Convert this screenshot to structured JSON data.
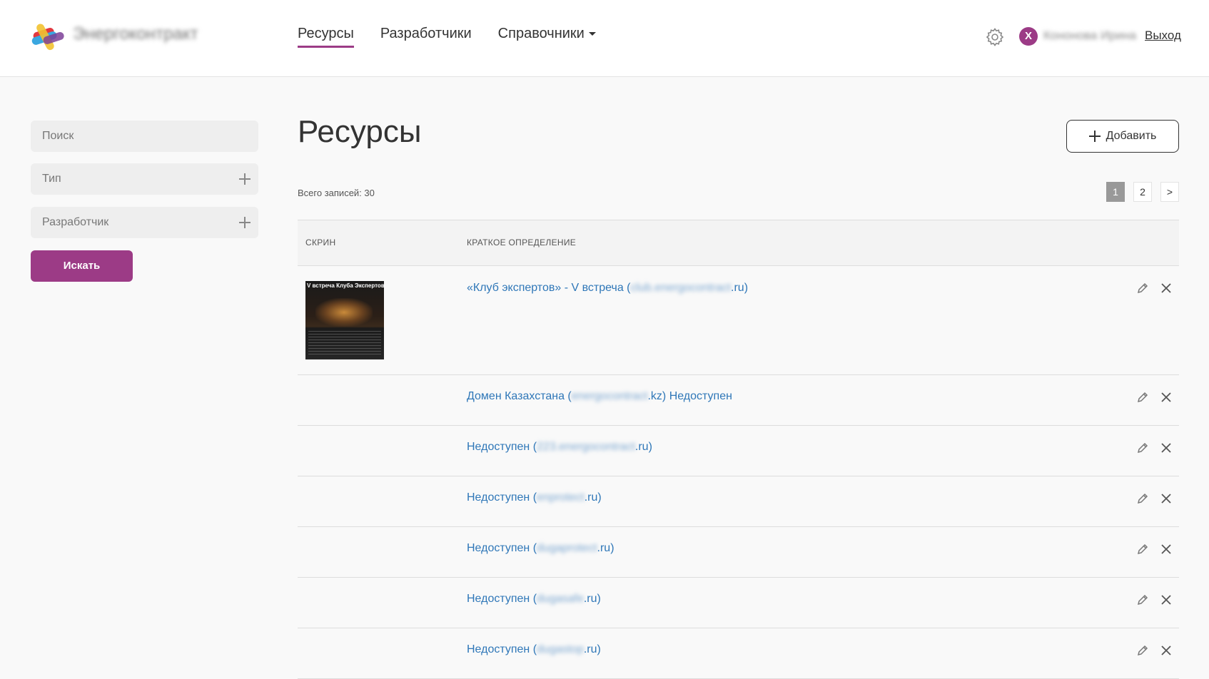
{
  "header": {
    "logo_text": "Энергоконтракт",
    "nav": [
      {
        "label": "Ресурсы",
        "active": true
      },
      {
        "label": "Разработчики",
        "active": false
      },
      {
        "label": "Справочники",
        "active": false
      }
    ],
    "avatar_letter": "Х",
    "username": "Кононова Ирина",
    "logout_label": "Выход"
  },
  "sidebar": {
    "search_placeholder": "Поиск",
    "type_label": "Тип",
    "developer_label": "Разработчик",
    "search_button": "Искать"
  },
  "main": {
    "title": "Ресурсы",
    "add_button": "Добавить",
    "total_label": "Всего записей: 30",
    "pagination": {
      "pages": [
        "1",
        "2"
      ],
      "current": "1",
      "next": ">"
    },
    "columns": {
      "screen": "СКРИН",
      "definition": "КРАТКОЕ ОПРЕДЕЛЕНИЕ"
    },
    "rows": [
      {
        "prefix": "«Клуб экспертов» - V встреча (",
        "blurred": "club.energocontract",
        "suffix": ".ru)",
        "thumb_title": "V встреча Клуба Экспертов"
      },
      {
        "prefix": "Домен Казахстана (",
        "blurred": "energocontract",
        "suffix": ".kz) Недоступен"
      },
      {
        "prefix": "Недоступен (",
        "blurred": "223.energocontract",
        "suffix": ".ru)"
      },
      {
        "prefix": "Недоступен (",
        "blurred": "enprotect",
        "suffix": ".ru)"
      },
      {
        "prefix": "Недоступен (",
        "blurred": "dugaprotect",
        "suffix": ".ru)"
      },
      {
        "prefix": "Недоступен (",
        "blurred": "dugasafe",
        "suffix": ".ru)"
      },
      {
        "prefix": "Недоступен (",
        "blurred": "dugastop",
        "suffix": ".ru)"
      }
    ]
  },
  "colors": {
    "accent": "#9c3b86",
    "link": "#2f77b8"
  },
  "icons": {
    "settings": "gear-icon",
    "edit": "pencil-icon",
    "delete": "close-icon",
    "add": "plus-icon"
  }
}
